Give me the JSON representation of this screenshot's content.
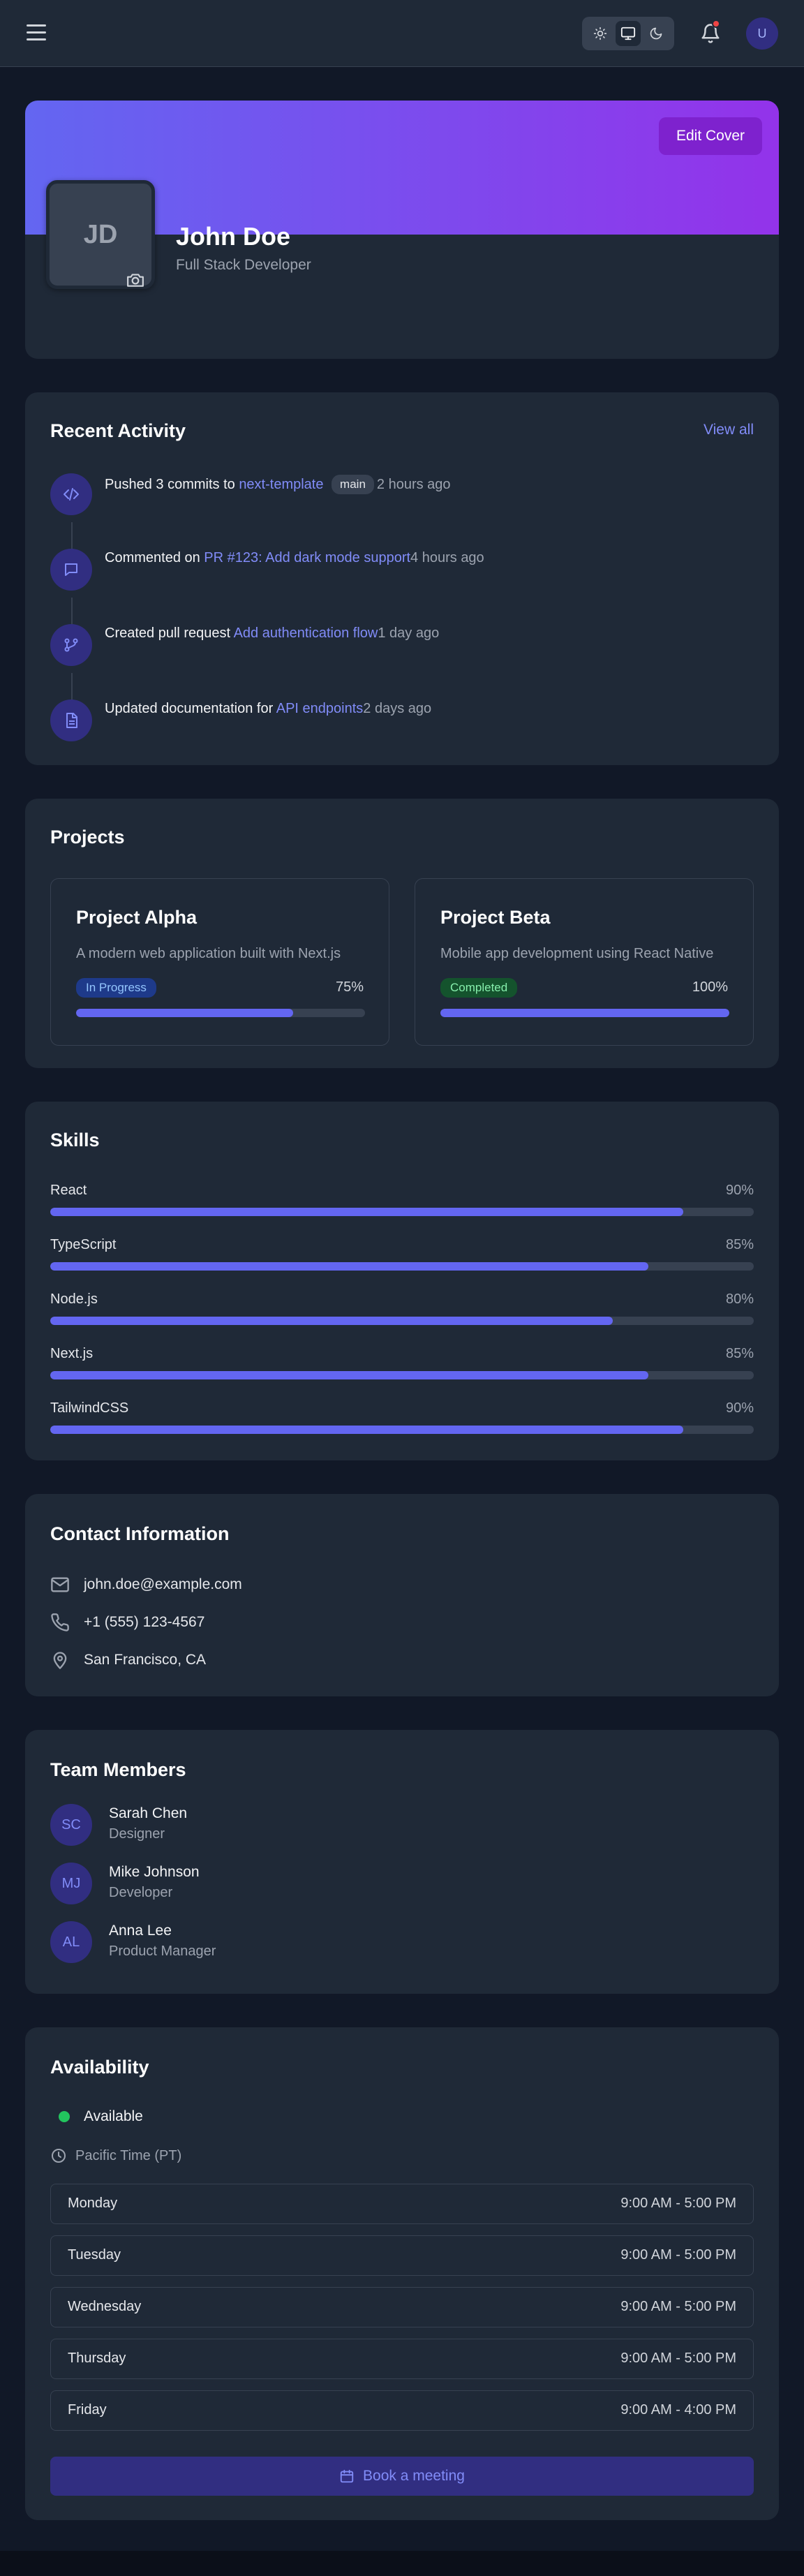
{
  "profile": {
    "initials": "JD",
    "name": "John Doe",
    "role": "Full Stack Developer",
    "edit_cover_label": "Edit Cover"
  },
  "header": {
    "user_initial": "U",
    "theme_options": [
      "sun-icon",
      "monitor-icon",
      "moon-icon"
    ],
    "active_theme": "monitor-icon",
    "has_notification": true
  },
  "activity": {
    "title": "Recent Activity",
    "view_all": "View all",
    "items": [
      {
        "icon": "code-icon",
        "prefix": "Pushed 3 commits to ",
        "link": "next-template",
        "badge": "main",
        "time": "2 hours ago"
      },
      {
        "icon": "comment-icon",
        "prefix": "Commented on ",
        "link": "PR #123: Add dark mode support",
        "time": "4 hours ago"
      },
      {
        "icon": "git-pull-request-icon",
        "prefix": "Created pull request ",
        "link": "Add authentication flow",
        "time": "1 day ago"
      },
      {
        "icon": "document-icon",
        "prefix": "Updated documentation for ",
        "link": "API endpoints",
        "time": "2 days ago"
      }
    ]
  },
  "projects": {
    "title": "Projects",
    "items": [
      {
        "name": "Project Alpha",
        "description": "A modern web application built with Next.js",
        "status": "In Progress",
        "progress_label": "75%",
        "progress": 0.75
      },
      {
        "name": "Project Beta",
        "description": "Mobile app development using React Native",
        "status": "Completed",
        "progress_label": "100%",
        "progress": 1.0
      }
    ]
  },
  "skills": {
    "title": "Skills",
    "items": [
      {
        "name": "React",
        "label": "90%",
        "level": 0.9
      },
      {
        "name": "TypeScript",
        "label": "85%",
        "level": 0.85
      },
      {
        "name": "Node.js",
        "label": "80%",
        "level": 0.8
      },
      {
        "name": "Next.js",
        "label": "85%",
        "level": 0.85
      },
      {
        "name": "TailwindCSS",
        "label": "90%",
        "level": 0.9
      }
    ]
  },
  "contact": {
    "title": "Contact Information",
    "email": "john.doe@example.com",
    "phone": "+1 (555) 123-4567",
    "location": "San Francisco, CA"
  },
  "team": {
    "title": "Team Members",
    "members": [
      {
        "initials": "SC",
        "name": "Sarah Chen",
        "role": "Designer"
      },
      {
        "initials": "MJ",
        "name": "Mike Johnson",
        "role": "Developer"
      },
      {
        "initials": "AL",
        "name": "Anna Lee",
        "role": "Product Manager"
      }
    ]
  },
  "availability": {
    "title": "Availability",
    "status": "Available",
    "timezone": "Pacific Time (PT)",
    "days": [
      {
        "day": "Monday",
        "hours": "9:00 AM - 5:00 PM"
      },
      {
        "day": "Tuesday",
        "hours": "9:00 AM - 5:00 PM"
      },
      {
        "day": "Wednesday",
        "hours": "9:00 AM - 5:00 PM"
      },
      {
        "day": "Thursday",
        "hours": "9:00 AM - 5:00 PM"
      },
      {
        "day": "Friday",
        "hours": "9:00 AM - 4:00 PM"
      }
    ],
    "book_label": "Book a meeting"
  },
  "colors": {
    "accent": "#6366f1",
    "accent_text": "#818cf8",
    "card": "#1f2937",
    "page": "#111827",
    "in_progress_badge": "#1e3a8a",
    "completed_badge": "#14532d",
    "available": "#22c55e"
  }
}
